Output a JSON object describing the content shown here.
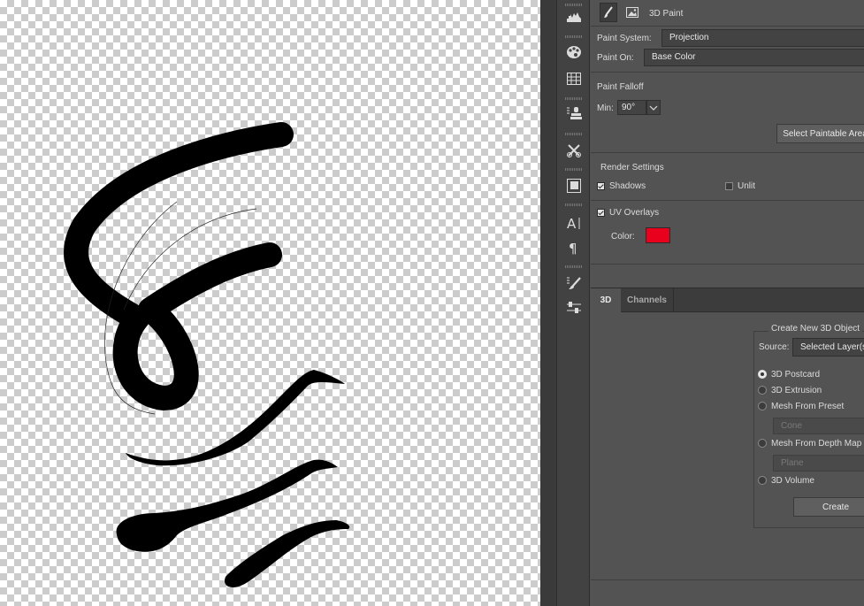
{
  "panel": {
    "tab_title": "3D Paint",
    "paint_system_label": "Paint System:",
    "paint_system_value": "Projection",
    "paint_on_label": "Paint On:",
    "paint_on_value": "Base Color",
    "paint_falloff_label": "Paint Falloff",
    "min_label": "Min:",
    "min_value": "90°",
    "select_paintable_label": "Select Paintable Area",
    "render_settings_label": "Render Settings",
    "shadows_label": "Shadows",
    "shadows_checked": true,
    "unlit_label": "Unlit",
    "unlit_checked": false,
    "uv_overlays_label": "UV Overlays",
    "uv_overlays_checked": true,
    "color_label": "Color:",
    "overlay_color": "#e8001c"
  },
  "tabs": [
    {
      "label": "3D",
      "active": true
    },
    {
      "label": "Channels",
      "active": false
    }
  ],
  "create3d": {
    "legend": "Create New 3D Object",
    "source_label": "Source:",
    "source_value": "Selected Layer(s)",
    "options": [
      {
        "label": "3D Postcard",
        "selected": true
      },
      {
        "label": "3D Extrusion",
        "selected": false
      },
      {
        "label": "Mesh From Preset",
        "selected": false
      },
      {
        "label": "Mesh From Depth Map",
        "selected": false
      },
      {
        "label": "3D Volume",
        "selected": false
      }
    ],
    "preset_value": "Cone",
    "depth_value": "Plane",
    "create_label": "Create"
  },
  "tools": [
    "histogram-icon",
    "color-palette-icon",
    "swatches-grid-icon",
    "clone-source-icon",
    "tool-presets-icon",
    "adjustments-icon",
    "character-icon",
    "paragraph-icon",
    "brush-settings-icon",
    "properties-sliders-icon"
  ],
  "colors": {
    "panel_bg": "#535353",
    "tab_bar": "#3c3c3c",
    "ink": "#000000"
  }
}
